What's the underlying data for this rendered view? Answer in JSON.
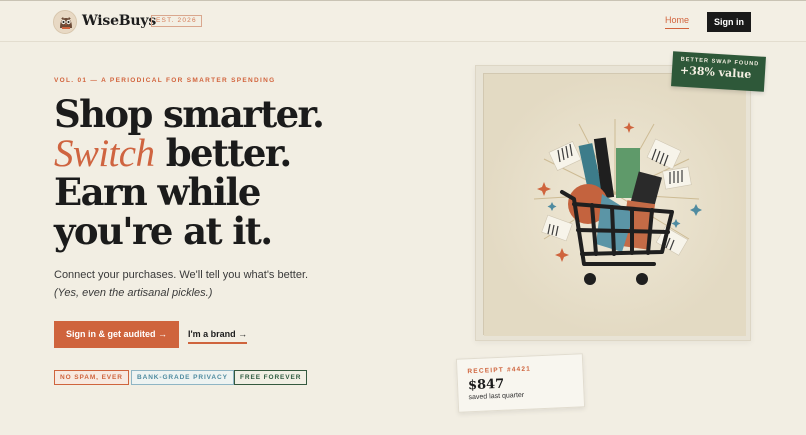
{
  "header": {
    "brand": "WiseBuys",
    "est": "EST. 2026",
    "nav_home": "Home",
    "nav_signin": "Sign in"
  },
  "hero": {
    "kicker": "VOL. 01 — A PERIODICAL FOR SMARTER SPENDING",
    "line1": "Shop smarter.",
    "line2_accent": "Switch",
    "line2_rest": " better.",
    "line3": "Earn while",
    "line4": "you're at it.",
    "lede": "Connect your purchases. We'll tell you what's better.",
    "aside": "(Yes, even the artisanal pickles.)",
    "cta_primary": "Sign in & get audited  →",
    "cta_secondary": "I'm a brand →"
  },
  "chips": [
    "NO SPAM, EVER",
    "BANK-GRADE PRIVACY",
    "FREE FOREVER"
  ],
  "swap_tag": {
    "label": "BETTER SWAP FOUND",
    "value": "+38% value"
  },
  "receipt": {
    "label": "RECEIPT #4421",
    "amount": "$847",
    "caption": "saved last quarter"
  },
  "colors": {
    "accent": "#cf643d",
    "green": "#2e5839",
    "ink": "#1b1b1b",
    "paper": "#f2eee3"
  },
  "icons": {
    "logo": "owl-icon",
    "illustration": "shopping-cart-illustration"
  }
}
